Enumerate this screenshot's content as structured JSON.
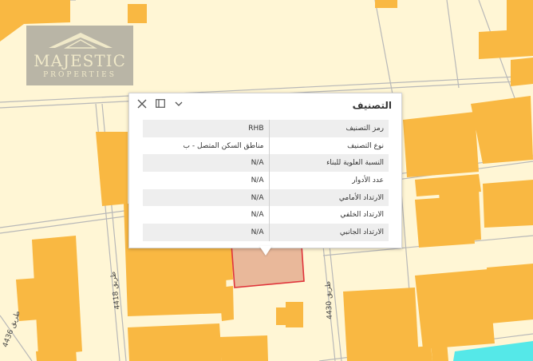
{
  "colors": {
    "background": "#fff6d5",
    "building": "#f9b842",
    "selected_fill": "#e9b89a",
    "selected_border": "#e0333a",
    "road_line": "#b8b8b8",
    "water": "#55e8e8"
  },
  "logo": {
    "name": "MAJESTIC",
    "sub": "PROPERTIES"
  },
  "popup": {
    "title": "التصنيف",
    "icons": {
      "close": "close-icon",
      "dock": "dock-icon",
      "collapse": "chevron-down-icon"
    },
    "rows": [
      {
        "field": "رمز التصنيف",
        "value": "RHB"
      },
      {
        "field": "نوع التصنيف",
        "value": "مناطق السكن المتصل - ب"
      },
      {
        "field": "النسبة العلوية للبناء",
        "value": "N/A"
      },
      {
        "field": "عدد الأدوار",
        "value": "N/A"
      },
      {
        "field": "الارتداد الأمامي",
        "value": "N/A"
      },
      {
        "field": "الارتداد الخلفي",
        "value": "N/A"
      },
      {
        "field": "الارتداد الجانبي",
        "value": "N/A"
      }
    ]
  },
  "road_labels": {
    "road_4418": "طريق 4418",
    "road_4430": "طريق 4430",
    "road_4436": "طريق 4436"
  }
}
